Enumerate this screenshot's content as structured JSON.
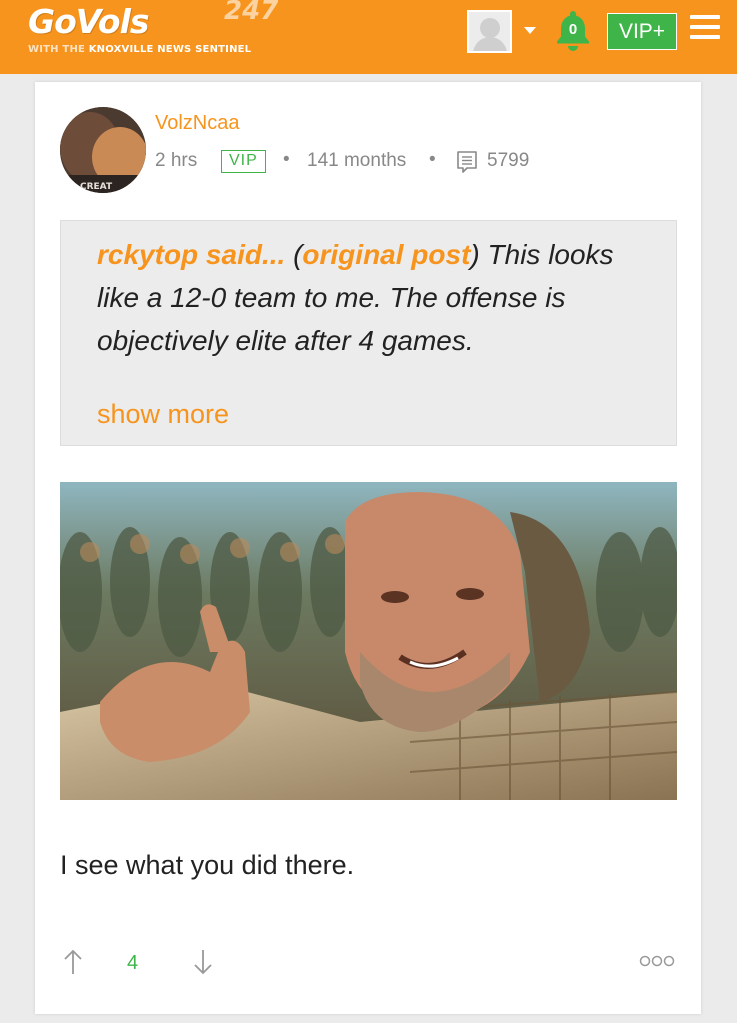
{
  "header": {
    "logo_main": "GoVols",
    "logo_sup": "247",
    "logo_tag_prefix": "WITH THE",
    "logo_tag_name": "KNOXVILLE NEWS SENTINEL",
    "notification_count": "0",
    "vip_button": "VIP+",
    "colors": {
      "brand": "#f7941d",
      "vip_green": "#3fb549"
    }
  },
  "post": {
    "author": "VolzNcaa",
    "time": "2 hrs",
    "badge": "VIP",
    "tenure": "141 months",
    "post_count": "5799",
    "quote": {
      "author_label": "rckytop said...",
      "link_label": "original post",
      "text": "This looks like a 12-0 team to me. The offense is objectively elite after 4 games.",
      "show_more": "show more"
    },
    "body": "I see what you did there.",
    "votes": "4"
  }
}
